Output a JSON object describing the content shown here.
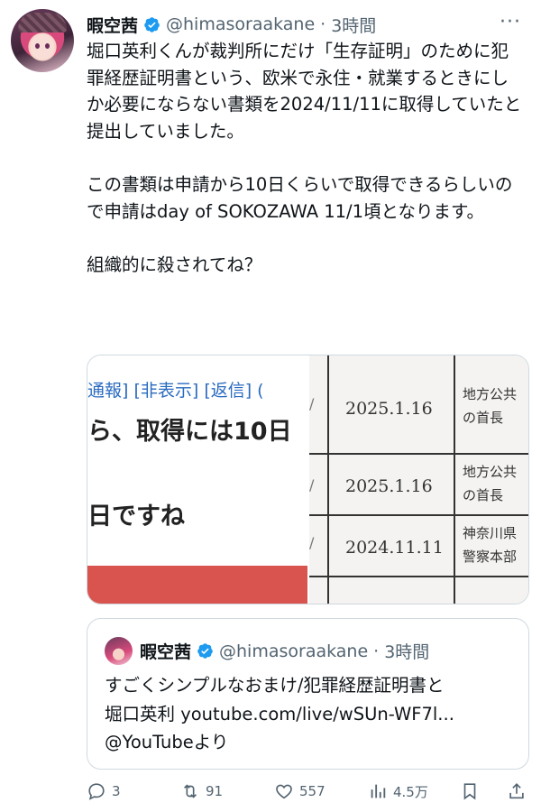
{
  "author": {
    "name": "暇空茜",
    "handle": "@himasoraakane",
    "separator": "·",
    "time": "3時間"
  },
  "more_label": "···",
  "tweet": {
    "paragraphs": [
      "堀口英利くんが裁判所にだけ「生存証明」のために犯罪経歴証明書という、欧米で永住・就業するときにしか必要にならない書類を2024/11/11に取得していたと提出していました。",
      "この書類は申請から10日くらいで取得できるらしいので申請はday of SOKOZAWA 11/1頃となります。",
      "組織的に殺されてね？"
    ]
  },
  "media": {
    "left": {
      "links": "通報] [非表示] [返信] (",
      "headline": "ら、取得には10日",
      "sub": "日ですね"
    },
    "right": {
      "rows": [
        {
          "date": "2025.1.16",
          "org_line1": "地方公共",
          "org_line2": "の首長"
        },
        {
          "date": "2025.1.16",
          "org_line1": "地方公共",
          "org_line2": "の首長"
        },
        {
          "date": "2024.11.11",
          "org_line1": "神奈川県",
          "org_line2": "警察本部"
        }
      ]
    }
  },
  "quote": {
    "name": "暇空茜",
    "handle": "@himasoraakane",
    "separator": "·",
    "time": "3時間",
    "lines": [
      "すごくシンプルなおまけ/犯罪経歴証明書と",
      "堀口英利 youtube.com/live/wSUn-WF7l...",
      "@YouTubeより"
    ]
  },
  "actions": {
    "replies": "3",
    "reposts": "91",
    "likes": "557",
    "views": "4.5万"
  },
  "colors": {
    "verified": "#1d9bf0",
    "secondary_text": "#536471",
    "border": "#cfd9de",
    "link_blue": "#2a6bc0",
    "media_red": "#d9534f"
  }
}
